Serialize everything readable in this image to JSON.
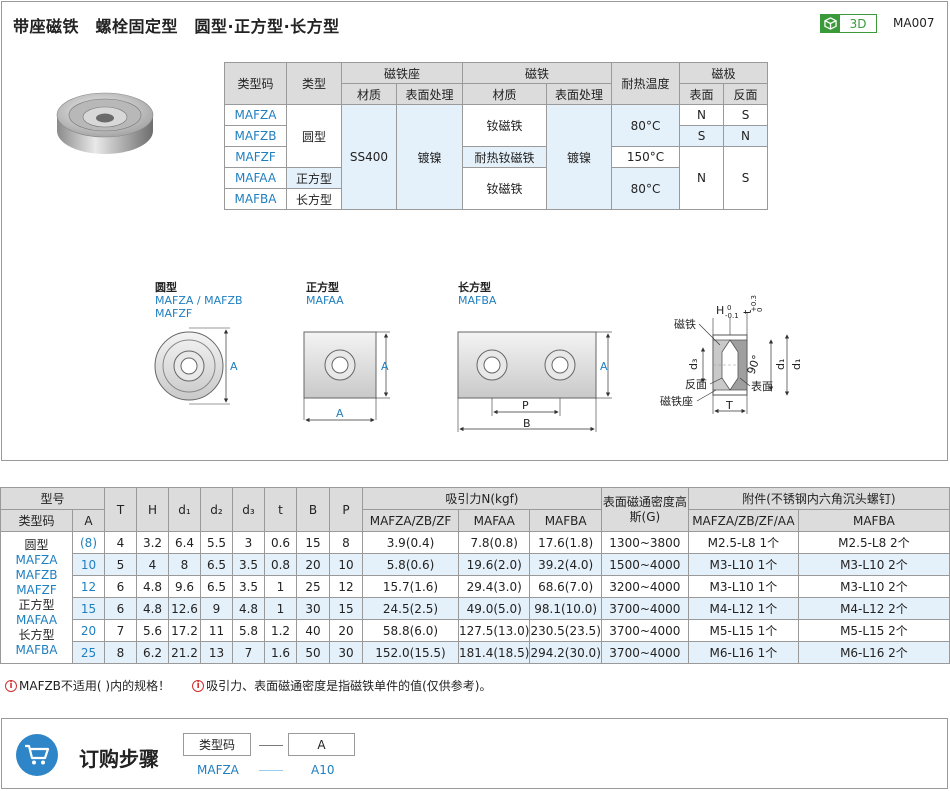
{
  "header": {
    "title": "带座磁铁　螺栓固定型　圆型·正方型·长方型",
    "badge": "3D",
    "code": "MA007"
  },
  "spec": {
    "h_code": "类型码",
    "h_type": "类型",
    "h_seat": "磁铁座",
    "h_magnet": "磁铁",
    "h_temp": "耐热温度",
    "h_pole": "磁极",
    "h_material": "材质",
    "h_surface": "表面处理",
    "h_material2": "材质",
    "h_surface2": "表面处理",
    "h_face": "表面",
    "h_back": "反面",
    "codes": [
      "MAFZA",
      "MAFZB",
      "MAFZF",
      "MAFAA",
      "MAFBA"
    ],
    "type_round": "圆型",
    "type_square": "正方型",
    "type_rect": "长方型",
    "seat_material": "SS400",
    "seat_surface": "镀镍",
    "mag_1": "钕磁铁",
    "mag_2": "耐热钕磁铁",
    "mag_3": "钕磁铁",
    "mag_surface": "镀镍",
    "temp_1": "80°C",
    "temp_2": "150°C",
    "temp_3": "80°C",
    "pole_a_face": "N",
    "pole_a_back": "S",
    "pole_b_face": "S",
    "pole_b_back": "N",
    "pole_c_face": "N",
    "pole_c_back": "S"
  },
  "drawings": {
    "round": {
      "title": "圆型",
      "codes_1": "MAFZA / MAFZB",
      "codes_2": "MAFZF"
    },
    "square": {
      "title": "正方型",
      "codes": "MAFAA"
    },
    "rect": {
      "title": "长方型",
      "codes": "MAFBA"
    },
    "dims": {
      "A": "A",
      "B": "B",
      "H": "H",
      "T": "T",
      "d1": "d₁",
      "d3": "d₃",
      "t": "t",
      "angle": "90°",
      "tol_h": "0",
      "tol_h2": "-0.1",
      "tol_t": "+0.3",
      "tol_t2": "0"
    },
    "section_labels": {
      "magnet": "磁铁",
      "back": "反面",
      "face": "表面",
      "seat": "磁铁座"
    }
  },
  "table": {
    "h_model": "型号",
    "h_code": "类型码",
    "h_A": "A",
    "h_T": "T",
    "h_H": "H",
    "h_d1": "d₁",
    "h_d2": "d₂",
    "h_d3": "d₃",
    "h_t": "t",
    "h_B": "B",
    "h_P": "P",
    "h_force": "吸引力N(kgf)",
    "h_f1": "MAFZA/ZB/ZF",
    "h_f2": "MAFAA",
    "h_f3": "MAFBA",
    "h_density": "表面磁通密度高斯(G)",
    "h_acc": "附件(不锈钢内六角沉头螺钉)",
    "h_acc1": "MAFZA/ZB/ZF/AA",
    "h_acc2": "MAFBA",
    "model_col": [
      "圆型",
      "MAFZA",
      "MAFZB",
      "MAFZF",
      "正方型",
      "MAFAA",
      "长方型",
      "MAFBA"
    ],
    "rows": [
      {
        "A": "(8)",
        "T": "4",
        "H": "3.2",
        "d1": "6.4",
        "d2": "5.5",
        "d3": "3",
        "t": "0.6",
        "B": "15",
        "P": "8",
        "f1": "3.9(0.4)",
        "f2": "7.8(0.8)",
        "f3": "17.6(1.8)",
        "g": "1300~3800",
        "a1": "M2.5-L8  1个",
        "a2": "M2.5-L8  2个"
      },
      {
        "A": "10",
        "T": "5",
        "H": "4",
        "d1": "8",
        "d2": "6.5",
        "d3": "3.5",
        "t": "0.8",
        "B": "20",
        "P": "10",
        "f1": "5.8(0.6)",
        "f2": "19.6(2.0)",
        "f3": "39.2(4.0)",
        "g": "1500~4000",
        "a1": "M3-L10  1个",
        "a2": "M3-L10  2个"
      },
      {
        "A": "12",
        "T": "6",
        "H": "4.8",
        "d1": "9.6",
        "d2": "6.5",
        "d3": "3.5",
        "t": "1",
        "B": "25",
        "P": "12",
        "f1": "15.7(1.6)",
        "f2": "29.4(3.0)",
        "f3": "68.6(7.0)",
        "g": "3200~4000",
        "a1": "M3-L10  1个",
        "a2": "M3-L10  2个"
      },
      {
        "A": "15",
        "T": "6",
        "H": "4.8",
        "d1": "12.6",
        "d2": "9",
        "d3": "4.8",
        "t": "1",
        "B": "30",
        "P": "15",
        "f1": "24.5(2.5)",
        "f2": "49.0(5.0)",
        "f3": "98.1(10.0)",
        "g": "3700~4000",
        "a1": "M4-L12  1个",
        "a2": "M4-L12  2个"
      },
      {
        "A": "20",
        "T": "7",
        "H": "5.6",
        "d1": "17.2",
        "d2": "11",
        "d3": "5.8",
        "t": "1.2",
        "B": "40",
        "P": "20",
        "f1": "58.8(6.0)",
        "f2": "127.5(13.0)",
        "f3": "230.5(23.5)",
        "g": "3700~4000",
        "a1": "M5-L15  1个",
        "a2": "M5-L15  2个"
      },
      {
        "A": "25",
        "T": "8",
        "H": "6.2",
        "d1": "21.2",
        "d2": "13",
        "d3": "7",
        "t": "1.6",
        "B": "50",
        "P": "30",
        "f1": "152.0(15.5)",
        "f2": "181.4(18.5)",
        "f3": "294.2(30.0)",
        "g": "3700~4000",
        "a1": "M6-L16  1个",
        "a2": "M6-L16  2个"
      }
    ]
  },
  "notes": [
    "MAFZB不适用(  )内的规格！",
    "吸引力、表面磁通密度是指磁铁单件的值(仅供参考)。"
  ],
  "order": {
    "title": "订购步骤",
    "h1": "类型码",
    "h2": "A",
    "v1": "MAFZA",
    "v2": "A10"
  }
}
